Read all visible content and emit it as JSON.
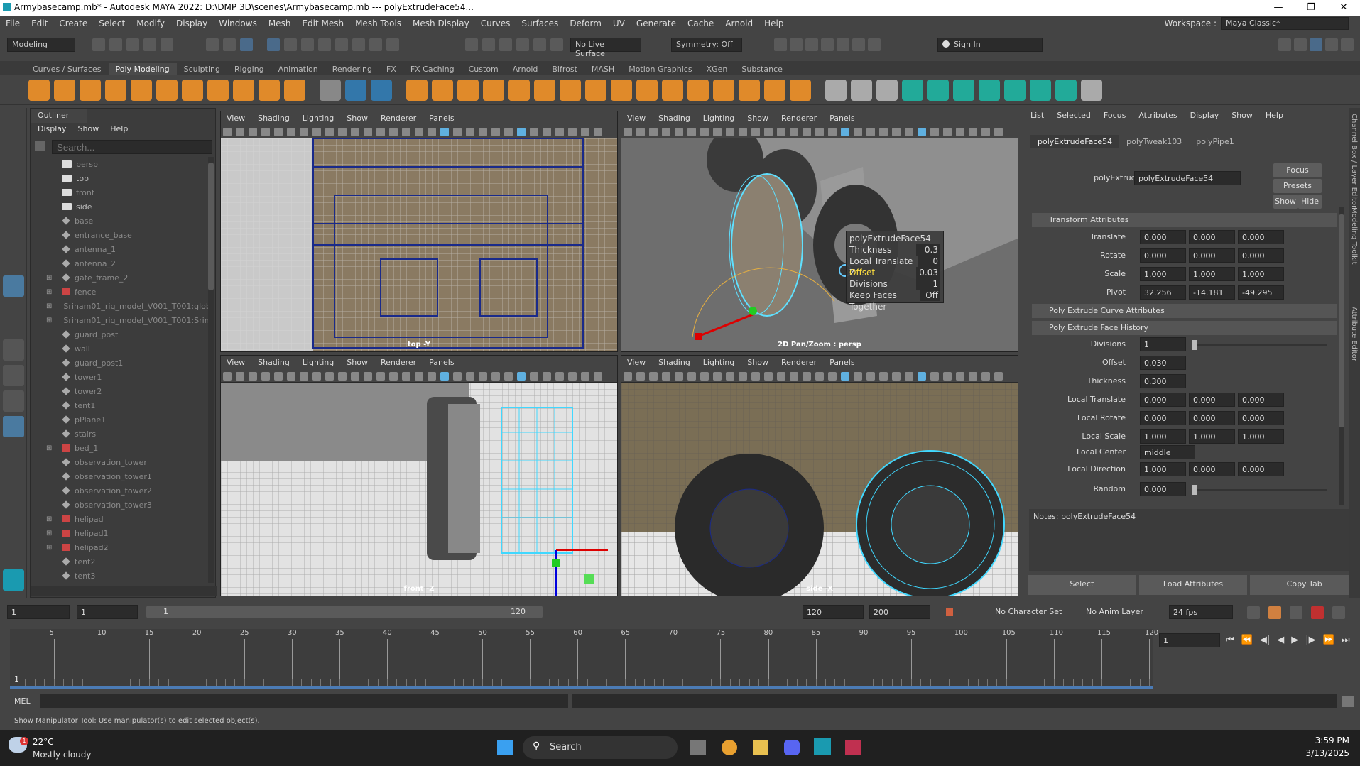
{
  "title": {
    "text": "Armybasecamp.mb* - Autodesk MAYA 2022: D:\\DMP 3D\\scenes\\Armybasecamp.mb   ---   polyExtrudeFace54...",
    "min": "—",
    "max": "❐",
    "close": "✕"
  },
  "menu": [
    "File",
    "Edit",
    "Create",
    "Select",
    "Modify",
    "Display",
    "Windows",
    "Mesh",
    "Edit Mesh",
    "Mesh Tools",
    "Mesh Display",
    "Curves",
    "Surfaces",
    "Deform",
    "UV",
    "Generate",
    "Cache",
    "Arnold",
    "Help"
  ],
  "workspace": {
    "label": "Workspace :",
    "value": "Maya Classic*"
  },
  "status": {
    "mode": "Modeling",
    "live": "No Live Surface",
    "symmetry": "Symmetry: Off",
    "signin": "Sign In"
  },
  "shelf_tabs": [
    "Curves / Surfaces",
    "Poly Modeling",
    "Sculpting",
    "Rigging",
    "Animation",
    "Rendering",
    "FX",
    "FX Caching",
    "Custom",
    "Arnold",
    "Bifrost",
    "MASH",
    "Motion Graphics",
    "XGen",
    "Substance"
  ],
  "outliner": {
    "tab": "Outliner",
    "menu": [
      "Display",
      "Show",
      "Help"
    ],
    "search_placeholder": "Search...",
    "items": [
      {
        "name": "persp",
        "type": "cam",
        "dim": true
      },
      {
        "name": "top",
        "type": "cam"
      },
      {
        "name": "front",
        "type": "cam",
        "dim": true
      },
      {
        "name": "side",
        "type": "cam"
      },
      {
        "name": "base",
        "type": "mesh",
        "dim": true
      },
      {
        "name": "entrance_base",
        "type": "mesh",
        "dim": true
      },
      {
        "name": "antenna_1",
        "type": "mesh",
        "dim": true
      },
      {
        "name": "antenna_2",
        "type": "mesh",
        "dim": true
      },
      {
        "name": "gate_frame_2",
        "type": "mesh",
        "dim": true,
        "exp": "⊞"
      },
      {
        "name": "fence",
        "type": "ref",
        "dim": true,
        "exp": "⊞"
      },
      {
        "name": "Srinam01_rig_model_V001_T001:globa",
        "type": "ref",
        "dim": true,
        "exp": "⊞"
      },
      {
        "name": "Srinam01_rig_model_V001_T001:Srina",
        "type": "ref",
        "dim": true,
        "exp": "⊞"
      },
      {
        "name": "guard_post",
        "type": "mesh",
        "dim": true
      },
      {
        "name": "wall",
        "type": "mesh",
        "dim": true
      },
      {
        "name": "guard_post1",
        "type": "mesh",
        "dim": true
      },
      {
        "name": "tower1",
        "type": "mesh",
        "dim": true
      },
      {
        "name": "tower2",
        "type": "mesh",
        "dim": true
      },
      {
        "name": "tent1",
        "type": "mesh",
        "dim": true
      },
      {
        "name": "pPlane1",
        "type": "mesh",
        "dim": true
      },
      {
        "name": "stairs",
        "type": "mesh",
        "dim": true
      },
      {
        "name": "bed_1",
        "type": "ref",
        "dim": true,
        "exp": "⊞"
      },
      {
        "name": "observation_tower",
        "type": "mesh",
        "dim": true
      },
      {
        "name": "observation_tower1",
        "type": "mesh",
        "dim": true
      },
      {
        "name": "observation_tower2",
        "type": "mesh",
        "dim": true
      },
      {
        "name": "observation_tower3",
        "type": "mesh",
        "dim": true
      },
      {
        "name": "helipad",
        "type": "ref",
        "dim": true,
        "exp": "⊞"
      },
      {
        "name": "helipad1",
        "type": "ref",
        "dim": true,
        "exp": "⊞"
      },
      {
        "name": "helipad2",
        "type": "ref",
        "dim": true,
        "exp": "⊞"
      },
      {
        "name": "tent2",
        "type": "mesh",
        "dim": true
      },
      {
        "name": "tent3",
        "type": "mesh",
        "dim": true
      }
    ]
  },
  "viewport_menu": [
    "View",
    "Shading",
    "Lighting",
    "Show",
    "Renderer",
    "Panels"
  ],
  "viewports": {
    "top_left": "top -Y",
    "top_right": "2D Pan/Zoom : persp",
    "bottom_left": "front -Z",
    "bottom_right": "side -X"
  },
  "hud": {
    "title": "polyExtrudeFace54",
    "rows": [
      [
        "Thickness",
        "0.3"
      ],
      [
        "Local Translate Z",
        "0"
      ],
      [
        "Offset",
        "0.03"
      ],
      [
        "Divisions",
        "1"
      ],
      [
        "Keep Faces Together",
        "Off"
      ]
    ]
  },
  "ae": {
    "menu": [
      "List",
      "Selected",
      "Focus",
      "Attributes",
      "Display",
      "Show",
      "Help"
    ],
    "tabs": [
      "polyExtrudeFace54",
      "polyTweak103",
      "polyPipe1"
    ],
    "node_label": "polyExtrudeFace:",
    "node_value": "polyExtrudeFace54",
    "focus": "Focus",
    "presets": "Presets",
    "show": "Show",
    "hide": "Hide",
    "sec_transform": "Transform Attributes",
    "sec_curve": "Poly Extrude Curve Attributes",
    "sec_history": "Poly Extrude Face History",
    "transform": [
      {
        "label": "Translate",
        "v": [
          "0.000",
          "0.000",
          "0.000"
        ]
      },
      {
        "label": "Rotate",
        "v": [
          "0.000",
          "0.000",
          "0.000"
        ]
      },
      {
        "label": "Scale",
        "v": [
          "1.000",
          "1.000",
          "1.000"
        ]
      },
      {
        "label": "Pivot",
        "v": [
          "32.256",
          "-14.181",
          "-49.295"
        ]
      }
    ],
    "divisions_label": "Divisions",
    "divisions": "1",
    "offset_label": "Offset",
    "offset": "0.030",
    "thickness_label": "Thickness",
    "thickness": "0.300",
    "local": [
      {
        "label": "Local Translate",
        "v": [
          "0.000",
          "0.000",
          "0.000"
        ]
      },
      {
        "label": "Local Rotate",
        "v": [
          "0.000",
          "0.000",
          "0.000"
        ]
      },
      {
        "label": "Local Scale",
        "v": [
          "1.000",
          "1.000",
          "1.000"
        ]
      }
    ],
    "local_center_label": "Local Center",
    "local_center": "middle",
    "local_direction_label": "Local Direction",
    "local_direction": [
      "1.000",
      "0.000",
      "0.000"
    ],
    "random_label": "Random",
    "random": "0.000",
    "notes": "Notes:  polyExtrudeFace54",
    "bottom": [
      "Select",
      "Load Attributes",
      "Copy Tab"
    ]
  },
  "right_tabs": [
    "Channel Box / Layer Editor",
    "Modeling Toolkit",
    "Attribute Editor"
  ],
  "range": {
    "start": "1",
    "start2": "1",
    "slider_start": "1",
    "slider_end": "120",
    "end": "120",
    "end2": "200",
    "char": "No Character Set",
    "anim": "No Anim Layer",
    "fps": "24 fps"
  },
  "ticks": [
    "1",
    "5",
    "10",
    "15",
    "20",
    "25",
    "30",
    "35",
    "40",
    "45",
    "50",
    "55",
    "60",
    "65",
    "70",
    "75",
    "80",
    "85",
    "90",
    "95",
    "100",
    "105",
    "110",
    "115",
    "120"
  ],
  "current_frame": "1",
  "current_marker": "1",
  "mel": "MEL",
  "help": "Show Manipulator Tool: Use manipulator(s) to edit selected object(s).",
  "taskbar": {
    "temp": "22°C",
    "weather": "Mostly cloudy",
    "weather_badge": "1",
    "search": "Search",
    "time": "3:59 PM",
    "date": "3/13/2025"
  }
}
